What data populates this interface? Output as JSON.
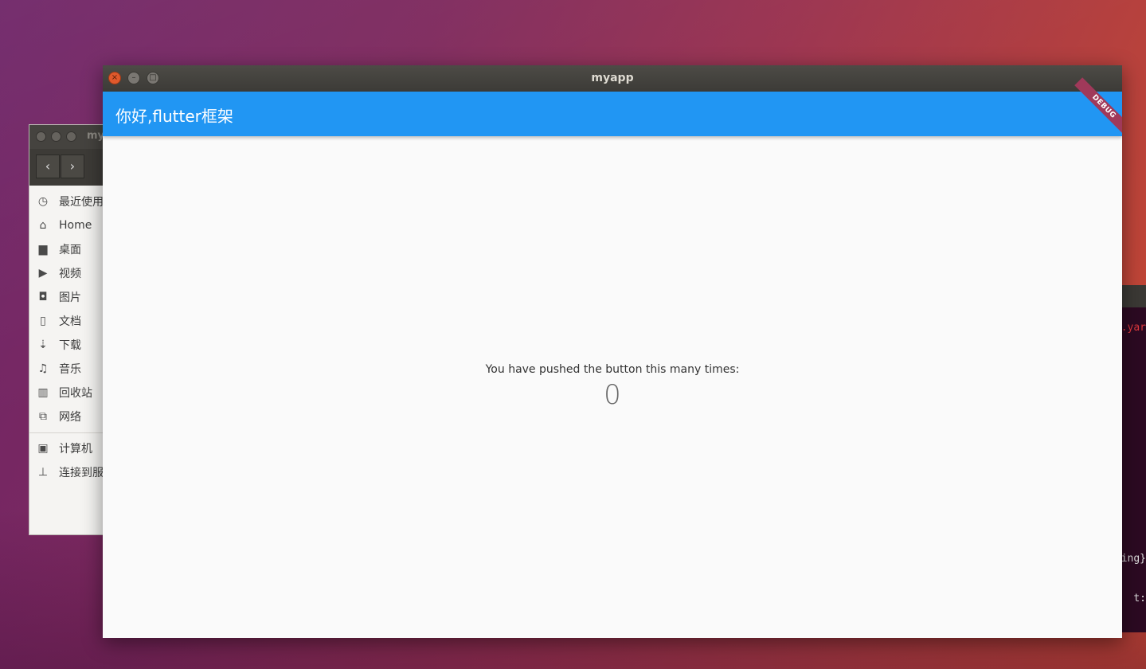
{
  "terminal": {
    "line1": ".yar",
    "line2": "ing}",
    "line3": "t:"
  },
  "file_manager": {
    "title": "my",
    "nav_back": "‹",
    "nav_forward": "›",
    "items": [
      {
        "icon": "clock-icon",
        "glyph": "◷",
        "label": "最近使用"
      },
      {
        "icon": "home-icon",
        "glyph": "⌂",
        "label": "Home"
      },
      {
        "icon": "folder-icon",
        "glyph": "▆",
        "label": "桌面"
      },
      {
        "icon": "video-icon",
        "glyph": "▶",
        "label": "视频"
      },
      {
        "icon": "camera-icon",
        "glyph": "◘",
        "label": "图片"
      },
      {
        "icon": "document-icon",
        "glyph": "▯",
        "label": "文档"
      },
      {
        "icon": "download-icon",
        "glyph": "⇣",
        "label": "下载"
      },
      {
        "icon": "music-icon",
        "glyph": "♫",
        "label": "音乐"
      },
      {
        "icon": "trash-icon",
        "glyph": "▥",
        "label": "回收站"
      },
      {
        "icon": "network-icon",
        "glyph": "⧉",
        "label": "网络"
      },
      {
        "icon": "computer-icon",
        "glyph": "▣",
        "label": "计算机"
      },
      {
        "icon": "server-icon",
        "glyph": "⊥",
        "label": "连接到服"
      }
    ]
  },
  "window": {
    "title": "myapp",
    "close_glyph": "×",
    "min_glyph": "–",
    "max_glyph": "□"
  },
  "app": {
    "appbar_title": "你好,flutter框架",
    "debug_banner": "DEBUG",
    "message": "You have pushed the button this many times:",
    "counter": "0",
    "fab_glyph": "+"
  },
  "colors": {
    "primary": "#2196f3",
    "close_button": "#e0592c",
    "terminal_bg": "#2c0a22"
  }
}
